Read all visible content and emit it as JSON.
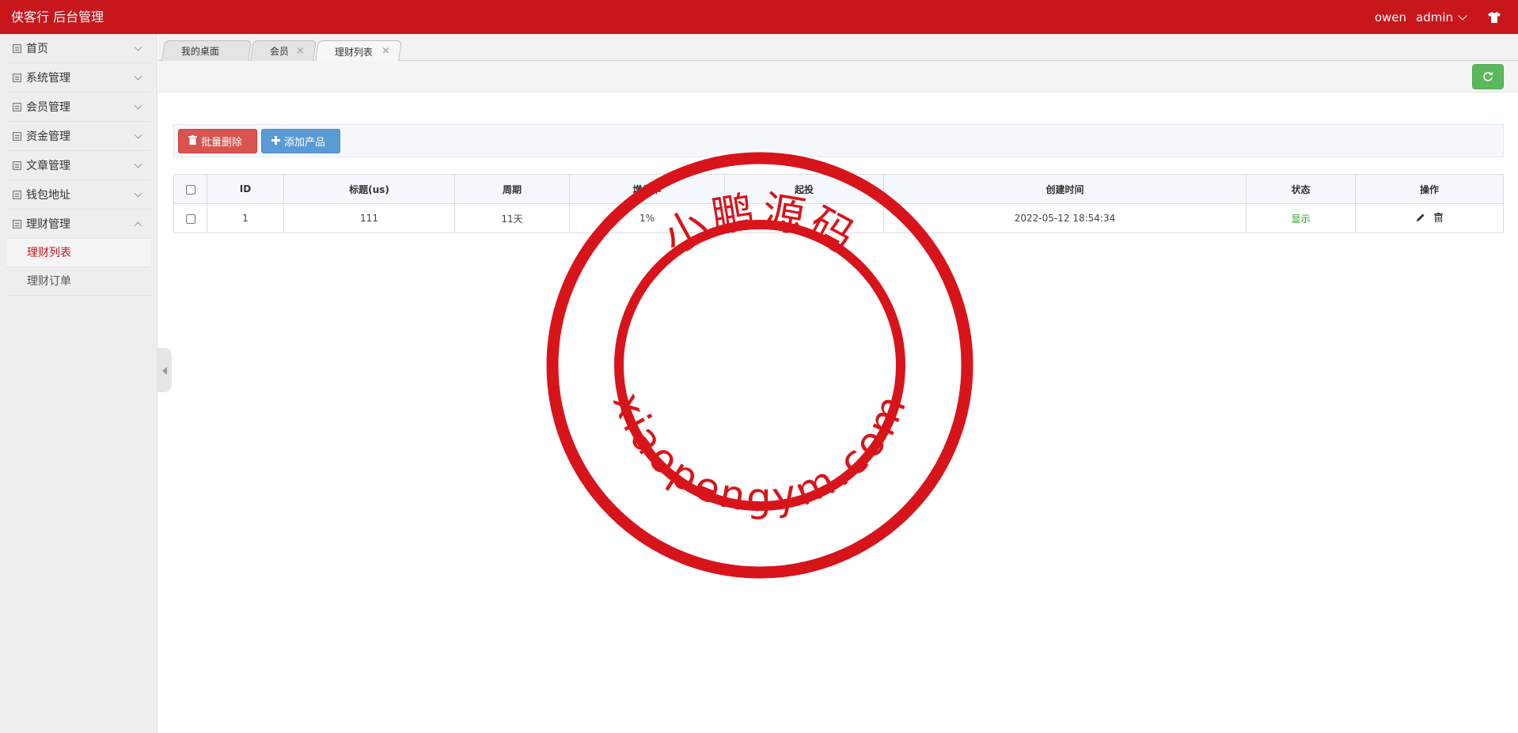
{
  "header": {
    "logo": "侠客行 后台管理",
    "user": "owen",
    "admin": "admin",
    "skin_icon": "tshirt-icon",
    "bg_color": "#c8161d"
  },
  "sidebar": {
    "items": [
      {
        "label": "首页",
        "icon": "list-icon",
        "expanded": false
      },
      {
        "label": "系统管理",
        "icon": "list-icon",
        "expanded": false
      },
      {
        "label": "会员管理",
        "icon": "list-icon",
        "expanded": false
      },
      {
        "label": "资金管理",
        "icon": "list-icon",
        "expanded": false
      },
      {
        "label": "文章管理",
        "icon": "list-icon",
        "expanded": false
      },
      {
        "label": "钱包地址",
        "icon": "list-icon",
        "expanded": false
      },
      {
        "label": "理财管理",
        "icon": "list-icon",
        "expanded": true
      }
    ],
    "sub_items": [
      {
        "label": "理财列表",
        "active": true
      },
      {
        "label": "理财订单",
        "active": false
      }
    ]
  },
  "tabs": [
    {
      "label": "我的桌面",
      "closable": false
    },
    {
      "label": "会员",
      "closable": true,
      "close": "×"
    },
    {
      "label": "理财列表",
      "closable": true,
      "close": "×",
      "active": true
    }
  ],
  "toolbar": {
    "batch_delete": "批量删除",
    "add_product": "添加产品"
  },
  "table": {
    "headers": [
      "ID",
      "标题(us)",
      "周期",
      "增值率",
      "起投",
      "创建时间",
      "状态",
      "操作"
    ],
    "rows": [
      {
        "id": "1",
        "title": "111",
        "period": "11天",
        "rate": "1%",
        "min": "",
        "created": "2022-05-12 18:54:34",
        "status": "显示"
      }
    ]
  },
  "watermark": {
    "cn": "小鹏源码",
    "en": "xiaopengym.com",
    "color": "#d8141b"
  }
}
